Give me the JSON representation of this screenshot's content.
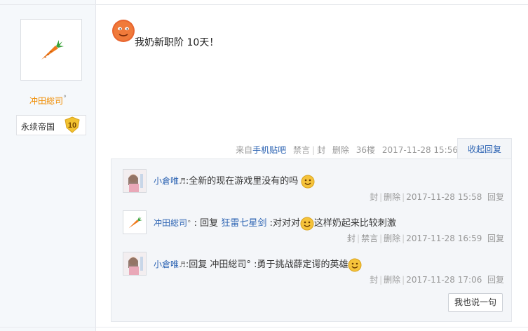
{
  "user": {
    "name": "冲田総司",
    "name_suffix": "°",
    "badge_name": "永续帝国",
    "badge_level": "10",
    "avatar_icon": "carrot-icon"
  },
  "post": {
    "content": "我奶新职阶 10天！",
    "emoji_icon": "face-emoji-icon",
    "tail": {
      "source_prefix": "来自",
      "source_link": "手机贴吧",
      "ban": "禁言",
      "seal": "封",
      "delete": "删除",
      "floor": "36楼",
      "time": "2017-11-28 15:56"
    },
    "collapse_label": "收起回复"
  },
  "replies": [
    {
      "user": "小倉唯",
      "user_suffix": "♬",
      "colon": ":",
      "text_parts": [
        "全新的现在游戏里没有的吗"
      ],
      "has_emoji": true,
      "actions": [
        "封",
        "删除"
      ],
      "time": "2017-11-28 15:58",
      "reply_label": "回复"
    },
    {
      "user": "冲田総司",
      "user_suffix": "°",
      "colon": " : ",
      "reply_prefix": "回复",
      "reply_to": "狂雷七星剑",
      "text_before_emoji": " :对对对",
      "text_after_emoji": "这样奶起来比较刺激",
      "actions": [
        "封",
        "禁言",
        "删除"
      ],
      "time": "2017-11-28 16:59",
      "reply_label": "回复"
    },
    {
      "user": "小倉唯",
      "user_suffix": "♬",
      "colon": ":",
      "reply_prefix": "回复",
      "reply_to_plain": " 冲田総司°",
      "text_after": " :勇于挑战薛定谔的英雄",
      "actions": [
        "封",
        "删除"
      ],
      "time": "2017-11-28 17:06",
      "reply_label": "回复"
    }
  ],
  "say_button": "我也说一句",
  "colors": {
    "link": "#2d64b3",
    "username": "#f08c00",
    "muted": "#999999"
  }
}
